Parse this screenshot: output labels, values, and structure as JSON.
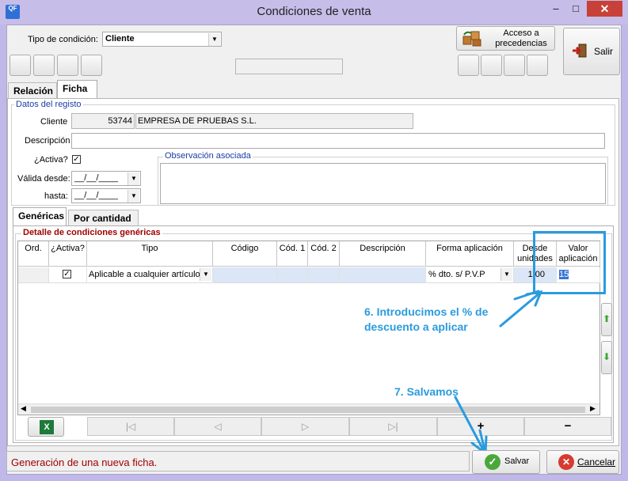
{
  "window": {
    "title": "Condiciones de venta",
    "app_icon_text": "QF",
    "minimize_glyph": "‒",
    "maximize_glyph": "□",
    "close_glyph": "✕"
  },
  "toolbar": {
    "tipo_condicion_label": "Tipo de condición:",
    "tipo_condicion_value": "Cliente",
    "acceso_precedencias_label": "Acceso a precedencias",
    "salir_label": "Salir"
  },
  "tabs_top": [
    "Relación",
    "Ficha"
  ],
  "datos": {
    "group_title": "Datos del registo",
    "cliente_label": "Cliente",
    "cliente_code": "53744",
    "cliente_name": "EMPRESA DE PRUEBAS S.L.",
    "descripcion_label": "Descripción",
    "descripcion_value": "",
    "activa_label": "¿Activa?",
    "activa_checked": "✓",
    "valida_desde_label": "Válida desde:",
    "valida_desde_value": "__/__/____",
    "hasta_label": "hasta:",
    "hasta_value": "__/__/____",
    "observacion_title": "Observación asociada"
  },
  "tabs_inner": [
    "Genéricas",
    "Por cantidad"
  ],
  "grid": {
    "group_title": "Detalle de condiciones genéricas",
    "columns": [
      "Ord.",
      "¿Activa?",
      "Tipo",
      "Código",
      "Cód. 1",
      "Cód. 2",
      "Descripción",
      "Forma aplicación",
      "Desde unidades",
      "Valor aplicación"
    ],
    "row": {
      "ord": "",
      "activa": "✓",
      "tipo": "Aplicable a cualquier artículo",
      "codigo": "",
      "cod1": "",
      "cod2": "",
      "descripcion": "",
      "forma": "% dto. s/ P.V.P",
      "desde": "1,00",
      "valor": "15"
    }
  },
  "nav": {
    "first": "|◁",
    "prev": "◁",
    "next": "▷",
    "last": "▷|",
    "add": "+",
    "remove": "−"
  },
  "annotations": {
    "step6": "6. Introducimos el % de descuento a aplicar",
    "step7": "7. Salvamos"
  },
  "status": {
    "message": "Generación de una nueva ficha.",
    "salvar_label": "Salvar",
    "cancelar_label": "Cancelar"
  },
  "colors": {
    "annotation": "#2a9bde",
    "status_text": "#a00000",
    "group_title": "#1b3f9f"
  }
}
